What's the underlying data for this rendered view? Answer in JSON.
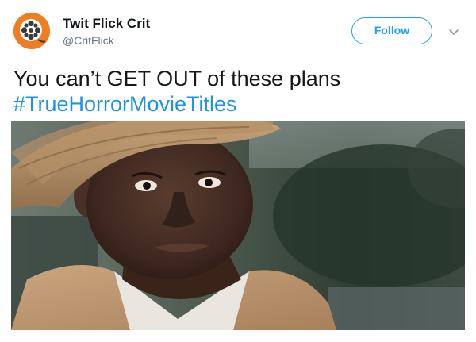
{
  "account": {
    "display_name": "Twit Flick Crit",
    "handle": "@CritFlick",
    "avatar_icon": "film-reel-icon",
    "avatar_color": "#f07d20"
  },
  "actions": {
    "follow_label": "Follow",
    "more_icon": "chevron-down-icon"
  },
  "tweet": {
    "text": "You can’t GET OUT of these plans",
    "hashtag": "#TrueHorrorMovieTitles"
  },
  "media": {
    "kind": "still image of a tearful man in a straw hat"
  },
  "colors": {
    "accent": "#1da1f2",
    "hashtag": "#1b95e0",
    "secondary_text": "#657786"
  }
}
